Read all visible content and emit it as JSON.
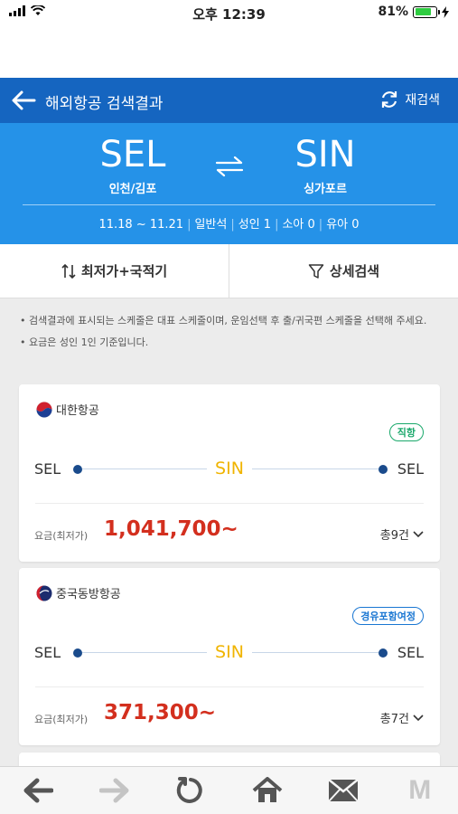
{
  "status_bar": {
    "time": "오후 12:39",
    "battery": "81%",
    "battery_level": 0.81
  },
  "header": {
    "title": "해외항공 검색결과",
    "research_label": "재검색"
  },
  "route": {
    "from_code": "SEL",
    "from_name": "인천/김포",
    "to_code": "SIN",
    "to_name": "싱가포르",
    "dates": "11.18 ~ 11.21",
    "cabin": "일반석",
    "adults": "성인 1",
    "children": "소아 0",
    "infants": "유아 0"
  },
  "tabs": {
    "sort_label": "최저가+국적기",
    "filter_label": "상세검색"
  },
  "notices": [
    "• 검색결과에 표시되는 스케줄은 대표 스케줄이며, 운임선택 후 출/귀국편 스케줄을 선택해 주세요.",
    "• 요금은 성인 1인 기준입니다."
  ],
  "results": [
    {
      "airline": "대한항공",
      "tag": "직항",
      "from": "SEL",
      "via": "SIN",
      "to": "SEL",
      "price_label": "요금(최저가)",
      "price": "1,041,700~",
      "count": "총9건"
    },
    {
      "airline": "중국동방항공",
      "tag": "경유포함여정",
      "from": "SEL",
      "via": "SIN",
      "to": "SEL",
      "price_label": "요금(최저가)",
      "price": "371,300~",
      "count": "총7건"
    }
  ],
  "colors": {
    "header": "#1565c0",
    "banner": "#2592e8",
    "price": "#d32f1e",
    "via": "#f0b400",
    "direct_tag": "#1aa86b",
    "transfer_tag": "#1976d2"
  },
  "bottom_nav": [
    "back-arrow-icon",
    "forward-arrow-icon",
    "refresh-icon",
    "home-icon",
    "mail-icon",
    "m-logo-icon"
  ],
  "bottom_nav_m": "M"
}
